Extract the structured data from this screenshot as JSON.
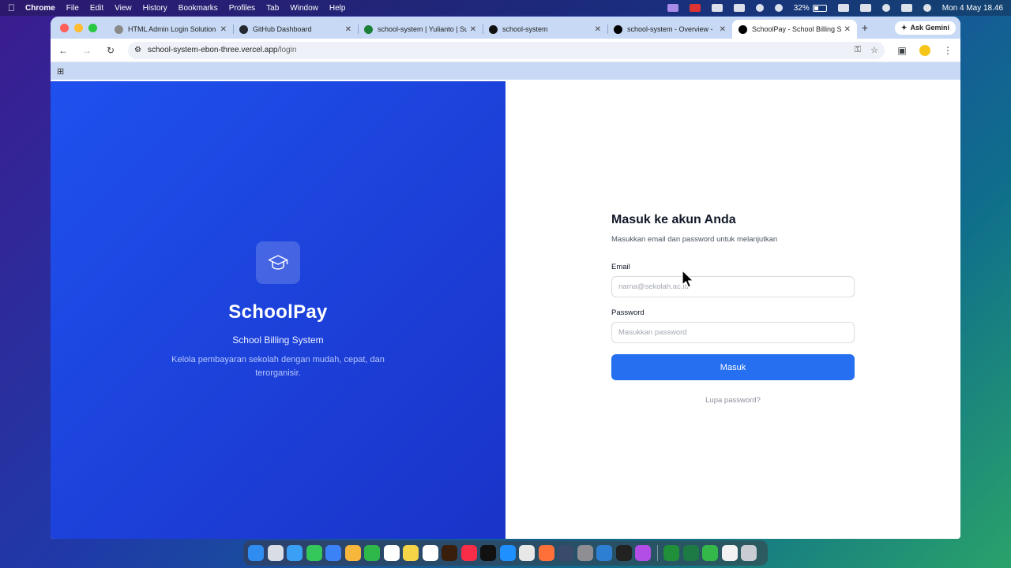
{
  "menubar": {
    "app": "Chrome",
    "items": [
      "File",
      "Edit",
      "View",
      "History",
      "Bookmarks",
      "Profiles",
      "Tab",
      "Window",
      "Help"
    ],
    "battery": "32%",
    "battery_level": 0.32,
    "datetime": "Mon 4 May  18.46"
  },
  "browser": {
    "tabs": [
      {
        "title": "HTML Admin Login Solution",
        "favicon_color": "#8a8a8a"
      },
      {
        "title": "GitHub Dashboard",
        "favicon_color": "#24292f"
      },
      {
        "title": "school-system | Yulianto | Su",
        "favicon_color": "#1a7f37"
      },
      {
        "title": "school-system",
        "favicon_color": "#111111"
      },
      {
        "title": "school-system - Overview -",
        "favicon_color": "#000000"
      },
      {
        "title": "SchoolPay - School Billing S",
        "favicon_color": "#000000"
      }
    ],
    "active_tab": 5,
    "gemini_label": "Ask Gemini",
    "url_host": "school-system-ebon-three.vercel.app",
    "url_path": "/login"
  },
  "hero": {
    "logo_icon": "graduation-cap-icon",
    "brand": "SchoolPay",
    "subtitle": "School Billing System",
    "tagline": "Kelola pembayaran sekolah dengan mudah, cepat, dan terorganisir.",
    "gradient_start": "#1f51ee",
    "gradient_end": "#1a33c8"
  },
  "login": {
    "title": "Masuk ke akun Anda",
    "subtitle": "Masukkan email dan password untuk melanjutkan",
    "email_label": "Email",
    "email_placeholder": "nama@sekolah.ac.id",
    "email_value": "",
    "password_label": "Password",
    "password_placeholder": "Masukkan password",
    "password_value": "",
    "submit_label": "Masuk",
    "forgot_label": "Lupa password?",
    "accent": "#256ff0"
  },
  "dock": {
    "apps": [
      {
        "name": "finder-icon",
        "color": "#2f8cf0"
      },
      {
        "name": "launchpad-icon",
        "color": "#d8dde6"
      },
      {
        "name": "safari-icon",
        "color": "#3aa0f5"
      },
      {
        "name": "messages-icon",
        "color": "#34c759"
      },
      {
        "name": "mail-icon",
        "color": "#3b82f6"
      },
      {
        "name": "photos-icon",
        "color": "#f6b73c"
      },
      {
        "name": "facetime-icon",
        "color": "#2fb84a"
      },
      {
        "name": "calendar-icon",
        "color": "#ffffff"
      },
      {
        "name": "notes-icon",
        "color": "#f5d547"
      },
      {
        "name": "reminders-icon",
        "color": "#ffffff"
      },
      {
        "name": "illustrator-icon",
        "color": "#3a1e0c"
      },
      {
        "name": "music-icon",
        "color": "#fa2d48"
      },
      {
        "name": "capcut-icon",
        "color": "#111111"
      },
      {
        "name": "app-store-icon",
        "color": "#1e90ff"
      },
      {
        "name": "chrome-icon",
        "color": "#e8e8e8"
      },
      {
        "name": "firefox-icon",
        "color": "#ff7139"
      },
      {
        "name": "xcode-instruments-icon",
        "color": "#3a4a6b"
      },
      {
        "name": "system-settings-icon",
        "color": "#8e8e93"
      },
      {
        "name": "vscode-icon",
        "color": "#2d7fd3"
      },
      {
        "name": "terminal-icon",
        "color": "#222222"
      },
      {
        "name": "podcast-icon",
        "color": "#b24de6"
      },
      {
        "name": "sheets-icon",
        "color": "#1f8f3a"
      },
      {
        "name": "excel-icon",
        "color": "#1d7a45"
      },
      {
        "name": "numbers-icon",
        "color": "#35b84a"
      },
      {
        "name": "document-icon",
        "color": "#f2f2f2"
      },
      {
        "name": "trash-icon",
        "color": "#c9ccd2"
      }
    ]
  }
}
